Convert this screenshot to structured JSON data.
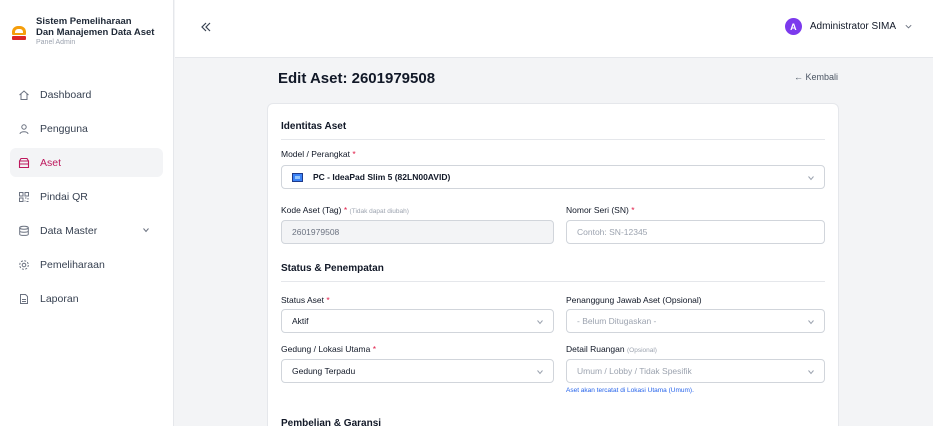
{
  "brand": {
    "title_line1": "Sistem Pemeliharaan",
    "title_line2": "Dan Manajemen Data Aset",
    "subtitle": "Panel Admin"
  },
  "sidebar": {
    "items": [
      {
        "label": "Dashboard",
        "icon": "home-icon"
      },
      {
        "label": "Pengguna",
        "icon": "users-icon"
      },
      {
        "label": "Aset",
        "icon": "box-icon",
        "active": true
      },
      {
        "label": "Pindai QR",
        "icon": "qr-code-icon"
      },
      {
        "label": "Data Master",
        "icon": "database-icon",
        "expandable": true
      },
      {
        "label": "Pemeliharaan",
        "icon": "gear-icon"
      },
      {
        "label": "Laporan",
        "icon": "document-icon"
      }
    ]
  },
  "topbar": {
    "user_initial": "A",
    "user_name": "Administrator SIMA"
  },
  "page": {
    "title": "Edit Aset: 2601979508",
    "back_label": "← Kembali"
  },
  "form": {
    "identitas": {
      "title": "Identitas Aset",
      "model_label": "Model / Perangkat",
      "model_value": "PC - IdeaPad Slim 5 (82LN00AVID)",
      "tag_label": "Kode Aset (Tag)",
      "tag_hint": "(Tidak dapat diubah)",
      "tag_value": "2601979508",
      "sn_label": "Nomor Seri (SN)",
      "sn_placeholder": "Contoh: SN-12345"
    },
    "status": {
      "title": "Status & Penempatan",
      "status_label": "Status Aset",
      "status_value": "Aktif",
      "pj_label": "Penanggung Jawab Aset (Opsional)",
      "pj_value": "- Belum Ditugaskan -",
      "gedung_label": "Gedung / Lokasi Utama",
      "gedung_value": "Gedung Terpadu",
      "ruangan_label": "Detail Ruangan",
      "ruangan_hint": "(Opsional)",
      "ruangan_value": "Umum / Lobby / Tidak Spesifik",
      "ruangan_note": "Aset akan tercatat di Lokasi Utama (Umum)."
    },
    "pembelian": {
      "title": "Pembelian & Garansi"
    }
  },
  "colors": {
    "accent": "#be185d",
    "required": "#e11d48",
    "avatar": "#7c3aed",
    "note": "#2563eb"
  }
}
